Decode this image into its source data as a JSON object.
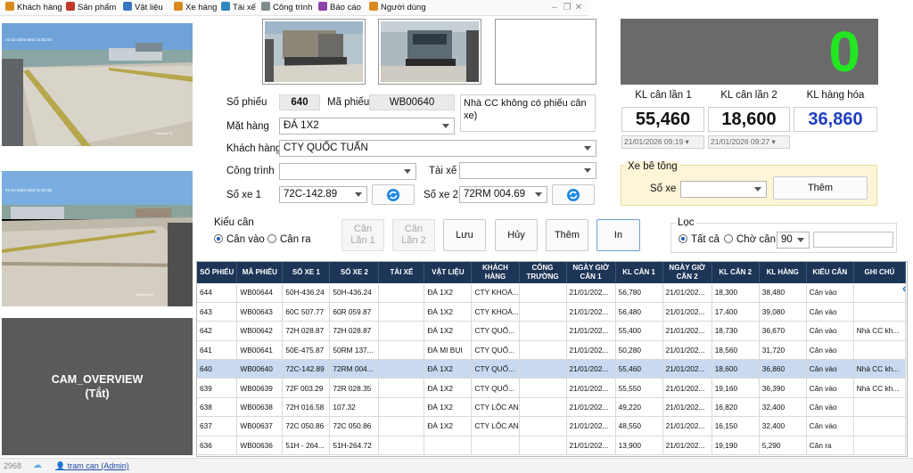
{
  "menu": [
    {
      "label": "Khách hàng",
      "icon": "customer-icon",
      "color": "#d98a1e"
    },
    {
      "label": "Sản phẩm",
      "icon": "product-icon",
      "color": "#c0392b"
    },
    {
      "label": "Vật liệu",
      "icon": "material-icon",
      "color": "#3a76c4"
    },
    {
      "label": "Xe hàng",
      "icon": "truck-icon",
      "color": "#d98a1e"
    },
    {
      "label": "Tài xế",
      "icon": "driver-icon",
      "color": "#2e86c1"
    },
    {
      "label": "Công trình",
      "icon": "construction-icon",
      "color": "#7f8c8d"
    },
    {
      "label": "Báo cáo",
      "icon": "report-icon",
      "color": "#8e44ad"
    },
    {
      "label": "Người dùng",
      "icon": "users-icon",
      "color": "#d98a1e"
    }
  ],
  "cameras": {
    "cam1_timestamp": "21-01-2026 Wed 11:50:04",
    "cam1_label": "Camera 01",
    "cam2_timestamp": "21-01-2026 Wed 11:50:06",
    "cam2_label": "Camera 02",
    "overview_title": "CAM_OVERVIEW",
    "overview_status": "(Tắt)"
  },
  "ticket": {
    "so_phieu_label": "Số phiếu",
    "so_phieu": "640",
    "ma_phieu_label": "Mã phiếu",
    "ma_phieu": "WB00640",
    "note": "Nhà CC không có phiếu cân xe)",
    "mat_hang_label": "Mặt hàng",
    "mat_hang": "ĐÁ 1X2",
    "khach_hang_label": "Khách hàng",
    "khach_hang": "CTY QUỐC TUẤN",
    "cong_trinh_label": "Công trình",
    "cong_trinh": "",
    "tai_xe_label": "Tài xế",
    "tai_xe": "",
    "so_xe1_label": "Số xe 1",
    "so_xe1": "72C-142.89",
    "so_xe2_label": "Số xe 2",
    "so_xe2": "72RM 004.69"
  },
  "kieu_can": {
    "label": "Kiểu cân",
    "option1": "Cân vào",
    "option2": "Cân ra",
    "selected": "Cân vào"
  },
  "actions": {
    "can_lan_1": "Cân\nLần 1",
    "can_lan_2": "Cân\nLần 2",
    "luu": "Lưu",
    "huy": "Hủy",
    "them": "Thêm",
    "in": "In"
  },
  "loc": {
    "label": "Lọc",
    "option1": "Tất cả",
    "option2": "Chờ cân",
    "selected": "Tất cả",
    "days": "90",
    "search": ""
  },
  "weights": {
    "scale_reading": "0",
    "kl_lan1_label": "KL cân lần 1",
    "kl_lan2_label": "KL cân lần 2",
    "kl_hang_label": "KL hàng hóa",
    "kl_lan1": "55,460",
    "kl_lan2": "18,600",
    "kl_hang": "36,860",
    "dt1": "21/01/2026 09:19",
    "dt2": "21/01/2026 09:27",
    "scale_color": "#22e622",
    "net_color": "#1f3fbf"
  },
  "be_tong": {
    "label": "Xe bê tông",
    "so_xe_label": "Số xe",
    "so_xe": "",
    "them": "Thêm"
  },
  "table": {
    "headers": [
      "SỐ PHIẾU",
      "MÃ PHIẾU",
      "SỐ XE 1",
      "SỐ XE 2",
      "TÀI XẾ",
      "VẬT LIỆU",
      "KHÁCH HÀNG",
      "CÔNG TRƯỜNG",
      "NGÀY GIỜ CÂN 1",
      "KL CÂN 1",
      "NGÀY GIỜ CÂN 2",
      "KL CÂN 2",
      "KL HÀNG",
      "KIỂU CÂN",
      "GHI CHÚ"
    ],
    "selected_index": 4,
    "rows": [
      [
        "644",
        "WB00644",
        "50H-436.24",
        "50H-436.24",
        "",
        "ĐÁ 1X2",
        "CTY KHOÁ...",
        "",
        "21/01/202...",
        "56,780",
        "21/01/202...",
        "18,300",
        "38,480",
        "Cân vào",
        ""
      ],
      [
        "643",
        "WB00643",
        "60C 507.77",
        "60R 059.87",
        "",
        "ĐÁ 1X2",
        "CTY KHOÁ...",
        "",
        "21/01/202...",
        "56,480",
        "21/01/202...",
        "17,400",
        "39,080",
        "Cân vào",
        ""
      ],
      [
        "642",
        "WB00642",
        "72H 028.87",
        "72H 028.87",
        "",
        "ĐÁ 1X2",
        "CTY QUỐ...",
        "",
        "21/01/202...",
        "55,400",
        "21/01/202...",
        "18,730",
        "36,670",
        "Cân vào",
        "Nhà CC kh..."
      ],
      [
        "641",
        "WB00641",
        "50E-475.87",
        "50RM 137...",
        "",
        "ĐÁ MI BỤI",
        "CTY QUỐ...",
        "",
        "21/01/202...",
        "50,280",
        "21/01/202...",
        "18,560",
        "31,720",
        "Cân vào",
        ""
      ],
      [
        "640",
        "WB00640",
        "72C-142.89",
        "72RM 004...",
        "",
        "ĐÁ 1X2",
        "CTY QUỐ...",
        "",
        "21/01/202...",
        "55,460",
        "21/01/202...",
        "18,600",
        "36,860",
        "Cân vào",
        "Nhà CC kh..."
      ],
      [
        "639",
        "WB00639",
        "72F 003.29",
        "72R 028.35",
        "",
        "ĐÁ 1X2",
        "CTY QUỐ...",
        "",
        "21/01/202...",
        "55,550",
        "21/01/202...",
        "19,160",
        "36,390",
        "Cân vào",
        "Nhà CC kh..."
      ],
      [
        "638",
        "WB00638",
        "72H 016.58",
        "107.32",
        "",
        "ĐÁ 1X2",
        "CTY LỘC AN",
        "",
        "21/01/202...",
        "49,220",
        "21/01/202...",
        "16,820",
        "32,400",
        "Cân vào",
        ""
      ],
      [
        "637",
        "WB00637",
        "72C 050.86",
        "72C 050.86",
        "",
        "ĐÁ 1X2",
        "CTY LỘC AN",
        "",
        "21/01/202...",
        "48,550",
        "21/01/202...",
        "16,150",
        "32,400",
        "Cân vào",
        ""
      ],
      [
        "636",
        "WB00636",
        "51H - 264...",
        "51H-264.72",
        "",
        "",
        "",
        "",
        "21/01/202...",
        "13,900",
        "21/01/202...",
        "19,190",
        "5,290",
        "Cân ra",
        ""
      ]
    ]
  },
  "status": {
    "count": "2968",
    "user": "tram can (Admin)"
  }
}
